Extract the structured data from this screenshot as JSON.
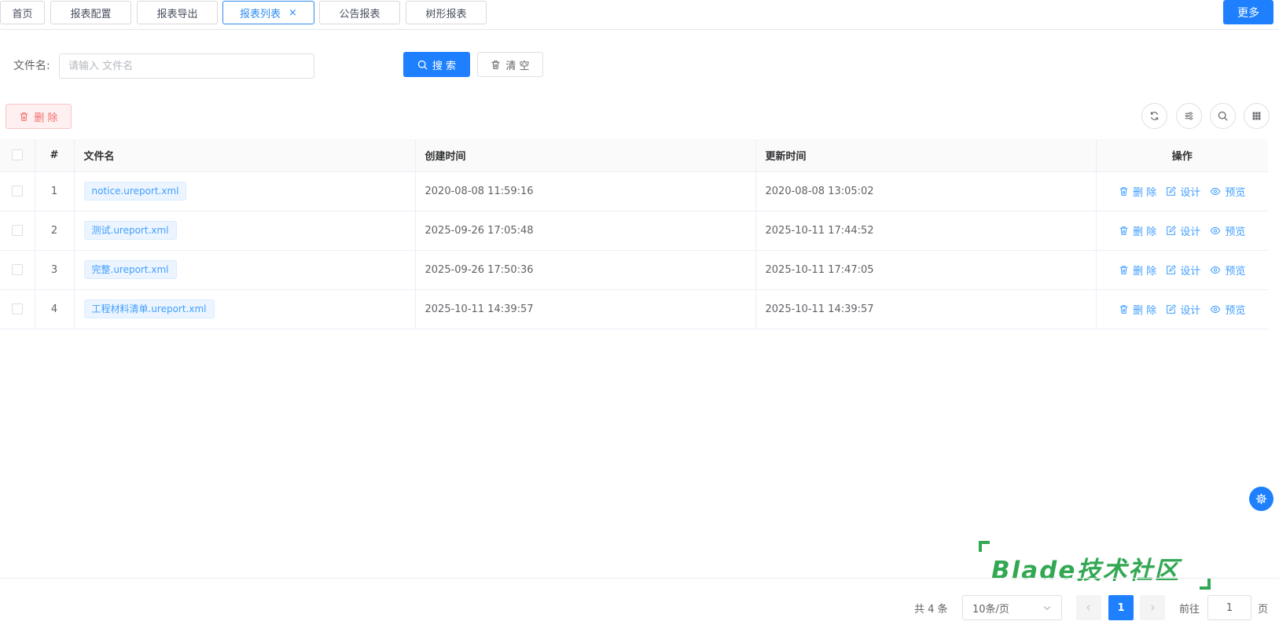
{
  "tabs": [
    {
      "label": "首页",
      "active": false
    },
    {
      "label": "报表配置",
      "active": false
    },
    {
      "label": "报表导出",
      "active": false
    },
    {
      "label": "报表列表",
      "active": true,
      "close": "×"
    },
    {
      "label": "公告报表",
      "active": false
    },
    {
      "label": "树形报表",
      "active": false
    }
  ],
  "more_label": "更多",
  "search": {
    "label": "文件名:",
    "placeholder": "请输入 文件名",
    "search_button": "搜 索",
    "clear_button": "清 空"
  },
  "toolbar": {
    "delete_button": "删 除",
    "tools": [
      "refresh-icon",
      "filter-settings-icon",
      "search-icon",
      "columns-grid-icon"
    ]
  },
  "table": {
    "columns": [
      "#",
      "文件名",
      "创建时间",
      "更新时间",
      "操作"
    ],
    "rows": [
      {
        "index": "1",
        "file": "notice.ureport.xml",
        "created": "2020-08-08 11:59:16",
        "updated": "2020-08-08 13:05:02"
      },
      {
        "index": "2",
        "file": "测试.ureport.xml",
        "created": "2025-09-26 17:05:48",
        "updated": "2025-10-11 17:44:52"
      },
      {
        "index": "3",
        "file": "完整.ureport.xml",
        "created": "2025-09-26 17:50:36",
        "updated": "2025-10-11 17:47:05"
      },
      {
        "index": "4",
        "file": "工程材料清单.ureport.xml",
        "created": "2025-10-11 14:39:57",
        "updated": "2025-10-11 14:39:57"
      }
    ],
    "actions": {
      "delete": "删 除",
      "design": "设计",
      "preview": "预览"
    }
  },
  "pagination": {
    "total_text": "共 4 条",
    "page_size": "10条/页",
    "current_page": "1",
    "goto_label": "前往",
    "goto_value": "1",
    "goto_suffix": "页"
  },
  "watermark": "Blade技术社区",
  "colors": {
    "primary": "#1e80ff",
    "danger": "#f56c6c",
    "watermark": "#33a853"
  }
}
